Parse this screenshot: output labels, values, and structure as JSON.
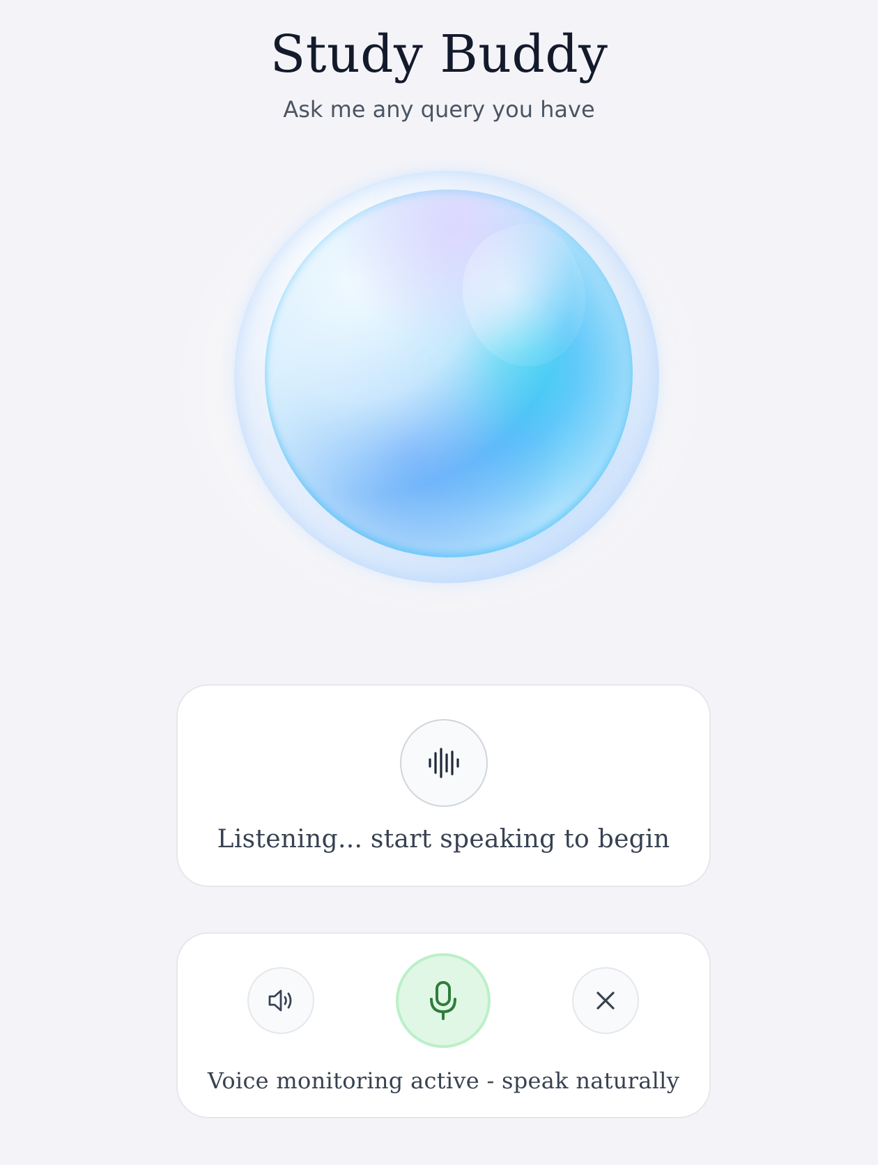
{
  "header": {
    "title": "Study Buddy",
    "subtitle": "Ask me any query you have"
  },
  "orb": {
    "icon": "voice-orb"
  },
  "status_card": {
    "icon": "audio-waveform-icon",
    "text": "Listening... start speaking to begin"
  },
  "controls": {
    "speaker_icon": "speaker-icon",
    "mic_icon": "microphone-icon",
    "close_icon": "close-icon",
    "status_text": "Voice monitoring active - speak naturally"
  },
  "colors": {
    "background": "#f4f4f8",
    "title": "#131a2b",
    "mic_active_bg": "#e1f7e6",
    "mic_active_icon": "#2e7d3a",
    "orb_cyan": "#22d3ee",
    "orb_blue": "#60a5fa"
  }
}
